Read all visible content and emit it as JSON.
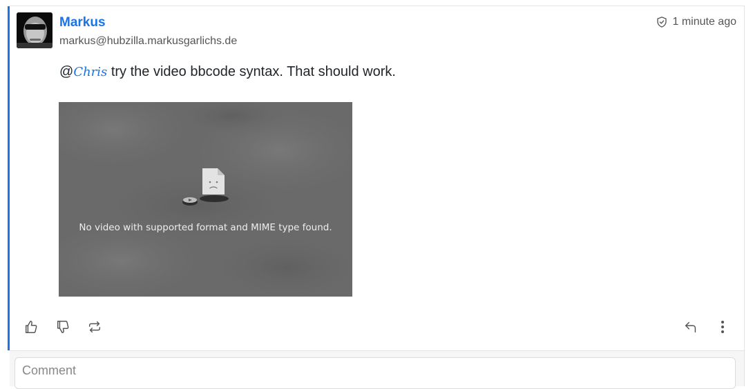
{
  "post": {
    "author_name": "Markus",
    "author_address": "markus@hubzilla.markusgarlichs.de",
    "time": "1 minute ago",
    "body_prefix": "@",
    "mention": "Chris",
    "body_text": " try the video bbcode syntax. That should work.",
    "video_message": "No video with supported format and MIME type found."
  },
  "comment": {
    "placeholder": "Comment"
  },
  "colors": {
    "accent": "#1a73e8",
    "video_background": "#6b6b6b"
  },
  "icons": [
    "shield-check-icon",
    "thumbs-up-icon",
    "thumbs-down-icon",
    "repeat-icon",
    "reply-icon",
    "more-vertical-icon",
    "broken-video-icon"
  ]
}
